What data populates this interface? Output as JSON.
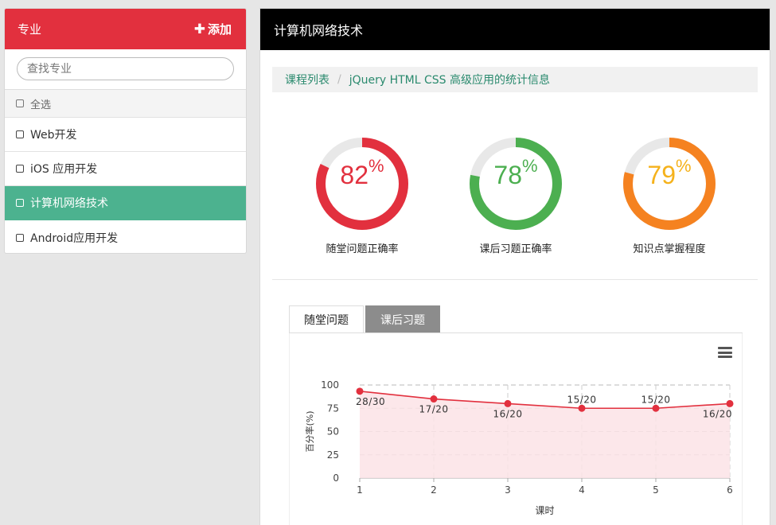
{
  "sidebar": {
    "title": "专业",
    "add_label": "添加",
    "search_placeholder": "查找专业",
    "select_all_label": "全选",
    "items": [
      {
        "label": "Web开发"
      },
      {
        "label": "iOS 应用开发"
      },
      {
        "label": "计算机网络技术"
      },
      {
        "label": "Android应用开发"
      }
    ],
    "active_index": 2
  },
  "main": {
    "title": "计算机网络技术",
    "breadcrumb": {
      "root": "课程列表",
      "separator": "/",
      "current": "jQuery HTML CSS 高级应用的统计信息"
    },
    "gauges": [
      {
        "value": "82",
        "unit": "%",
        "label": "随堂问题正确率",
        "percent": 82,
        "color": "#e2303e"
      },
      {
        "value": "78",
        "unit": "%",
        "label": "课后习题正确率",
        "percent": 78,
        "color": "#4caf50"
      },
      {
        "value": "79",
        "unit": "%",
        "label": "知识点掌握程度",
        "percent": 79,
        "color": "#f58220"
      }
    ],
    "tabs": [
      {
        "label": "随堂问题",
        "active": true
      },
      {
        "label": "课后习题",
        "active": false
      }
    ]
  },
  "colors": {
    "accent_red": "#e2303e",
    "active_green": "#4cb28f",
    "area_fill": "#fbe3e6"
  },
  "chart_data": {
    "type": "area",
    "x": [
      1,
      2,
      3,
      4,
      5,
      6
    ],
    "values": [
      93.3,
      85,
      80,
      75,
      75,
      80
    ],
    "point_labels": [
      "28/30",
      "17/20",
      "16/20",
      "15/20",
      "15/20",
      "16/20"
    ],
    "xlabel": "课时",
    "ylabel": "百分率(%)",
    "yticks": [
      0,
      25,
      50,
      75,
      100
    ],
    "ylim": [
      0,
      100
    ],
    "grid": true,
    "color": "#e2303e"
  }
}
